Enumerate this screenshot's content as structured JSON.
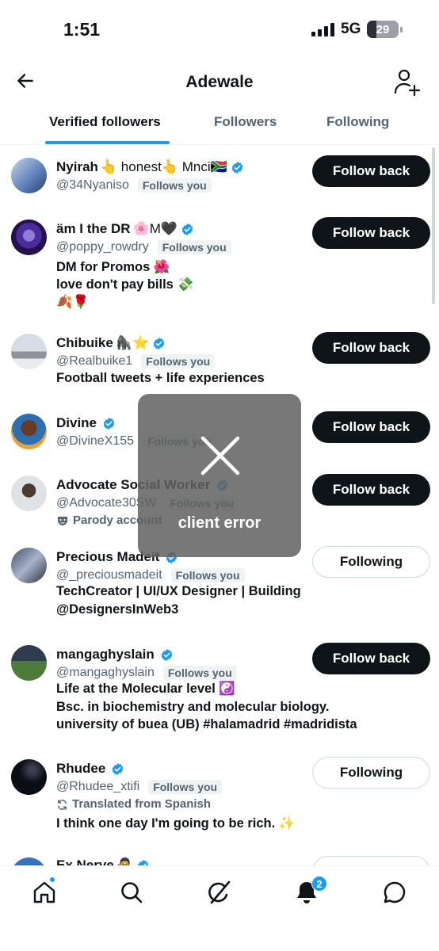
{
  "status_bar": {
    "time": "1:51",
    "network": "5G",
    "battery": "29",
    "battery_level": 0.29
  },
  "header": {
    "title": "Adewale"
  },
  "tabs": [
    {
      "label": "Verified followers",
      "active": true
    },
    {
      "label": "Followers",
      "active": false
    },
    {
      "label": "Following",
      "active": false
    }
  ],
  "badge_label": "Follows you",
  "translated_label": "Translated from Spanish",
  "error": {
    "text": "client error"
  },
  "users": [
    {
      "name": "Nyirah",
      "name_suffix": "👆 honest👆 Mnci🇿🇦",
      "handle": "@34Nyaniso",
      "bio": [],
      "button": "Follow back"
    },
    {
      "name": "äm I the DR",
      "name_suffix": "🌸M🖤",
      "handle": "@poppy_rowdry",
      "bio": [
        "DM for Promos 🌺",
        "love don't pay bills 💸",
        "🍂🌹"
      ],
      "button": "Follow back"
    },
    {
      "name": "Chibuike",
      "name_suffix": "🦍⭐",
      "handle": "@Realbuike1",
      "bio": [
        "Football tweets + life experiences"
      ],
      "button": "Follow back"
    },
    {
      "name": "Divine",
      "name_suffix": "",
      "handle": "@DivineX155",
      "bio": [],
      "button": "Follow back"
    },
    {
      "name": "Advocate Social Worker",
      "name_suffix": "",
      "handle": "@Advocate30SW",
      "label": "Parody account",
      "bio": [],
      "button": "Follow back"
    },
    {
      "name": "Precious Madeit",
      "name_suffix": "",
      "handle": "@_preciousmadeit",
      "bio": [
        "TechCreator | UI/UX Designer | Building",
        "@DesignersInWeb3"
      ],
      "button": "Following"
    },
    {
      "name": "mangaghyslain",
      "name_suffix": "",
      "handle": "@mangaghyslain",
      "bio": [
        "Life at the Molecular level ☯️",
        "Bsc. in biochemistry and molecular biology.",
        "university of buea (UB) #halamadrid #madridista"
      ],
      "button": "Follow back"
    },
    {
      "name": "Rhudee",
      "name_suffix": "",
      "handle": "@Rhudee_xtifi",
      "bio": [
        "I think one day I'm going to be rich. ✨"
      ],
      "button": "Following"
    },
    {
      "name": "Ex Nerve",
      "name_suffix": "🥷",
      "handle": "",
      "bio": [],
      "button": ""
    }
  ],
  "colors": {
    "accent": "#1d9bf0",
    "text": "#0f1419",
    "muted": "#536471"
  },
  "bottom_nav": {
    "items": [
      "home-icon",
      "search-icon",
      "grok-icon",
      "notifications-icon",
      "messages-icon"
    ],
    "notification_count": "2"
  }
}
